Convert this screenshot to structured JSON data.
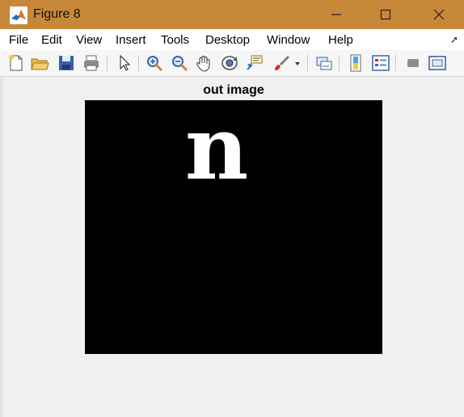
{
  "window": {
    "title": "Figure 8",
    "accent_color": "#c8883a"
  },
  "menu": {
    "items": [
      "File",
      "Edit",
      "View",
      "Insert",
      "Tools",
      "Desktop",
      "Window",
      "Help"
    ]
  },
  "toolbar": {
    "buttons": [
      "new-figure-icon",
      "open-file-icon",
      "save-icon",
      "print-icon",
      "pointer-icon",
      "zoom-in-icon",
      "zoom-out-icon",
      "pan-icon",
      "rotate-3d-icon",
      "data-cursor-icon",
      "brush-icon",
      "link-plot-icon",
      "colorbar-icon",
      "legend-icon",
      "hide-plot-tools-icon",
      "show-plot-tools-icon"
    ]
  },
  "axes": {
    "title": "out image",
    "image_background": "#000000",
    "glyph_text": "n",
    "glyph_color": "#ffffff"
  }
}
